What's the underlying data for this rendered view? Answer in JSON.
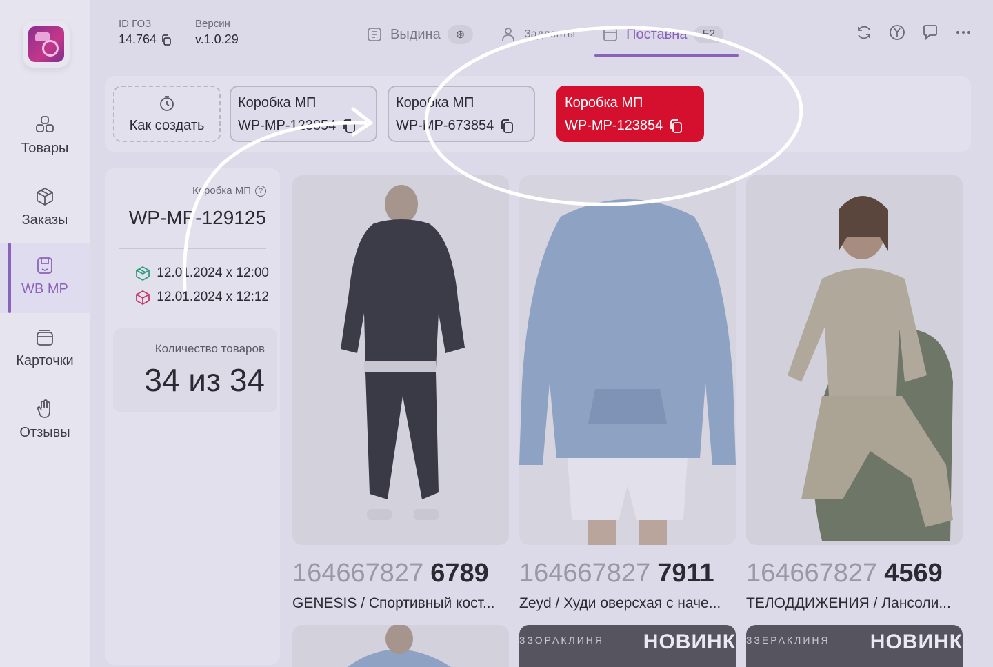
{
  "sidebar": {
    "items": [
      {
        "label": "Товары",
        "icon": "boxes-icon"
      },
      {
        "label": "Заказы",
        "icon": "package-icon"
      },
      {
        "label": "WB MP",
        "icon": "save-box-icon",
        "active": true
      },
      {
        "label": "Карточки",
        "icon": "card-stack-icon"
      },
      {
        "label": "Отзывы",
        "icon": "hand-icon"
      }
    ]
  },
  "header": {
    "id_label": "ID ГОЗ",
    "id_value": "14.764",
    "version_label": "Версин",
    "version_value": "v.1.0.29"
  },
  "tabs": [
    {
      "label": "Выдина",
      "badge": "⊛",
      "active": false
    },
    {
      "label": "Задлонты",
      "badge": "",
      "active": false
    },
    {
      "label": "Поставна",
      "badge": "F2",
      "active": true
    }
  ],
  "top_actions": [
    "refresh-icon",
    "yandex-icon",
    "chat-icon",
    "more-icon"
  ],
  "strip": {
    "create_label": "Как создать",
    "boxes": [
      {
        "title": "Коробка МП",
        "code": "WP-MP-123854",
        "active": false
      },
      {
        "title": "Коробка МП",
        "code": "WP-MP-673854",
        "active": false
      },
      {
        "title": "Коробка МП",
        "code": "WP-MP-123854",
        "active": true
      }
    ]
  },
  "info": {
    "label": "Коробка МП",
    "help": "?",
    "code": "WP-MP-129125",
    "date1": "12.01.2024 х 12:00",
    "date2": "12.01.2024 х 12:12",
    "qty_label": "Количество товаров",
    "qty_value": "34 из 34"
  },
  "products": [
    {
      "id_a": "164667827",
      "id_b": "6789",
      "name": "GENESIS / Спортивный кост..."
    },
    {
      "id_a": "164667827",
      "id_b": "7911",
      "name": "Zeyd / Худи оверсхая с наче..."
    },
    {
      "id_a": "164667827",
      "id_b": "4569",
      "name": "ТЕЛОДДИЖЕНИЯ / Лансоли..."
    }
  ],
  "row2": [
    {
      "brand": "",
      "tag": ""
    },
    {
      "brand": "ЗЗОРАКЛИНЯ",
      "tag": "НОВИНК"
    },
    {
      "brand": "ЗЗЕРАКЛИНЯ",
      "tag": "НОВИНК"
    }
  ],
  "colors": {
    "accent": "#8a63b8",
    "active_box": "#d5102f",
    "background": "#dcdae8"
  }
}
